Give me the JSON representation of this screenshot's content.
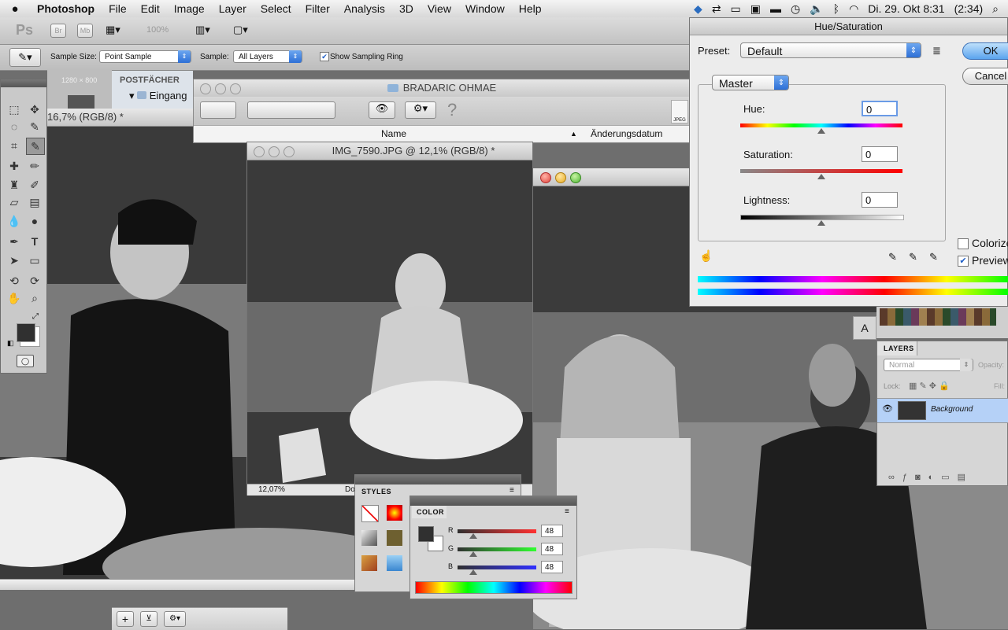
{
  "menubar": {
    "app_name": "Photoshop",
    "items": [
      "File",
      "Edit",
      "Image",
      "Layer",
      "Select",
      "Filter",
      "Analysis",
      "3D",
      "View",
      "Window",
      "Help"
    ],
    "clock": "Di. 29. Okt  8:31",
    "battery": "(2:34)"
  },
  "appbar": {
    "logo": "Ps",
    "br": "Br",
    "mb": "Mb",
    "zoom": "100%"
  },
  "options": {
    "sample_size_label": "Sample Size:",
    "sample_size_value": "Point Sample",
    "sample_label": "Sample:",
    "sample_value": "All Layers",
    "sampling_ring_label": "Show Sampling Ring",
    "sampling_ring_checked": true
  },
  "navigator": {
    "label": "1280 × 800"
  },
  "finder": {
    "postfaecher": "POSTFÄCHER",
    "inbox": "Eingang",
    "folder_title": "BRADARIC OHMAE",
    "col_name": "Name",
    "col_date": "Änderungsdatum",
    "file_icon": "JPEG"
  },
  "doc_left": {
    "title": "16,7% (RGB/8) *"
  },
  "doc_mid": {
    "title": "IMG_7590.JPG @ 12,1% (RGB/8) *",
    "zoom_status": "12,07%",
    "doc_status": "Do"
  },
  "hue_sat": {
    "title": "Hue/Saturation",
    "preset_label": "Preset:",
    "preset_value": "Default",
    "channel": "Master",
    "hue_label": "Hue:",
    "hue_value": "0",
    "sat_label": "Saturation:",
    "sat_value": "0",
    "light_label": "Lightness:",
    "light_value": "0",
    "ok": "OK",
    "cancel": "Cancel",
    "colorize": "Colorize",
    "colorize_checked": false,
    "preview": "Preview",
    "preview_checked": true
  },
  "styles_panel": {
    "tab": "STYLES"
  },
  "color_panel": {
    "tab": "COLOR",
    "r_label": "R",
    "r_value": "48",
    "g_label": "G",
    "g_value": "48",
    "b_label": "B",
    "b_value": "48"
  },
  "layers_panel": {
    "tab": "LAYERS",
    "blend_mode": "Normal",
    "opacity_label": "Opacity:",
    "lock_label": "Lock:",
    "fill_label": "Fill:",
    "layer_name": "Background"
  },
  "colors": {
    "accent": "#3c7be0",
    "selection": "#b5d1f7"
  }
}
